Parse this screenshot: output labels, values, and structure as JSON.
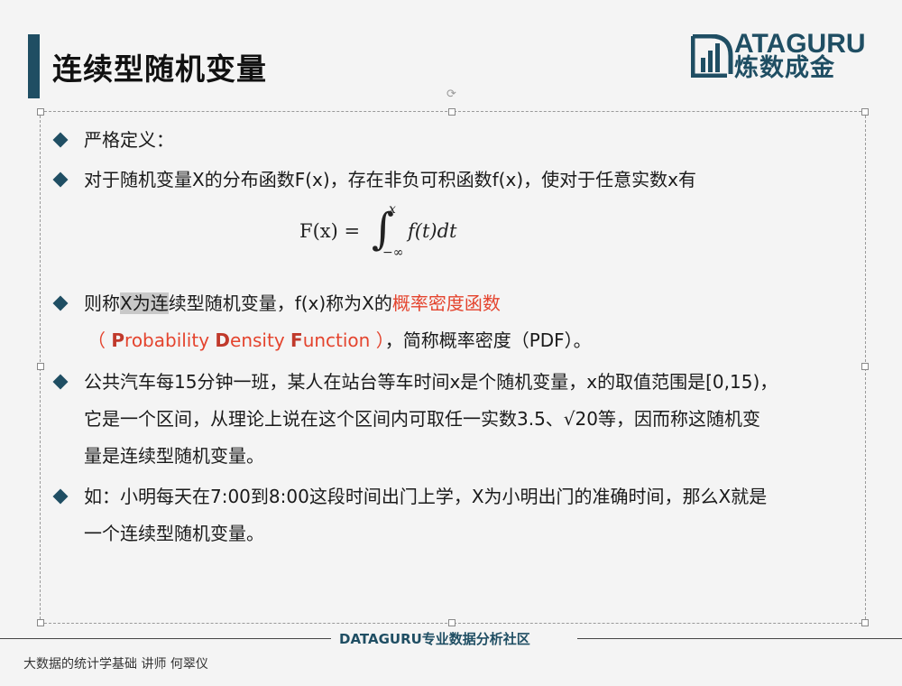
{
  "slide": {
    "title": "连续型随机变量"
  },
  "logo": {
    "text_en": "ATAGURU",
    "text_cn": "炼数成金",
    "brand_color": "#1f4e63"
  },
  "bullets": [
    {
      "text": "严格定义："
    },
    {
      "text": "对于随机变量X的分布函数F(x)，存在非负可积函数f(x)，使对于任意实数x有"
    },
    {
      "pre": "则称",
      "highlighted": "X为连",
      "mid": "续型随机变量，f(x)称为X的",
      "red": "概率密度函数",
      "line2_open": "（ ",
      "pdf_p": "P",
      "pdf_rest1": "robability ",
      "pdf_d": "D",
      "pdf_rest2": "ensity ",
      "pdf_f": "F",
      "pdf_rest3": "unction ）",
      "line2_tail": "，简称概率密度（PDF）。"
    },
    {
      "line1": "公共汽车每15分钟一班，某人在站台等车时间x是个随机变量，x的取值范围是[0,15)，",
      "line2": "它是一个区间，从理论上说在这个区间内可取任一实数3.5、√20等，因而称这随机变",
      "line3": "量是连续型随机变量。"
    },
    {
      "line1": "如：小明每天在7:00到8:00这段时间出门上学，X为小明出门的准确时间，那么X就是",
      "line2": "一个连续型随机变量。"
    }
  ],
  "formula": {
    "left": "F(x) =",
    "integral": "∫",
    "upper": "x",
    "lower": "−∞",
    "body": "f(t)dt"
  },
  "footer": {
    "brand": "DATAGURU专业数据分析社区",
    "course": "大数据的统计学基础   讲师 何翠仪"
  },
  "colors": {
    "accent": "#1f4e63",
    "highlight_red": "#e4442e"
  },
  "icons": {
    "bullet": "diamond-bullet-icon",
    "rotate": "rotate-handle-icon"
  }
}
